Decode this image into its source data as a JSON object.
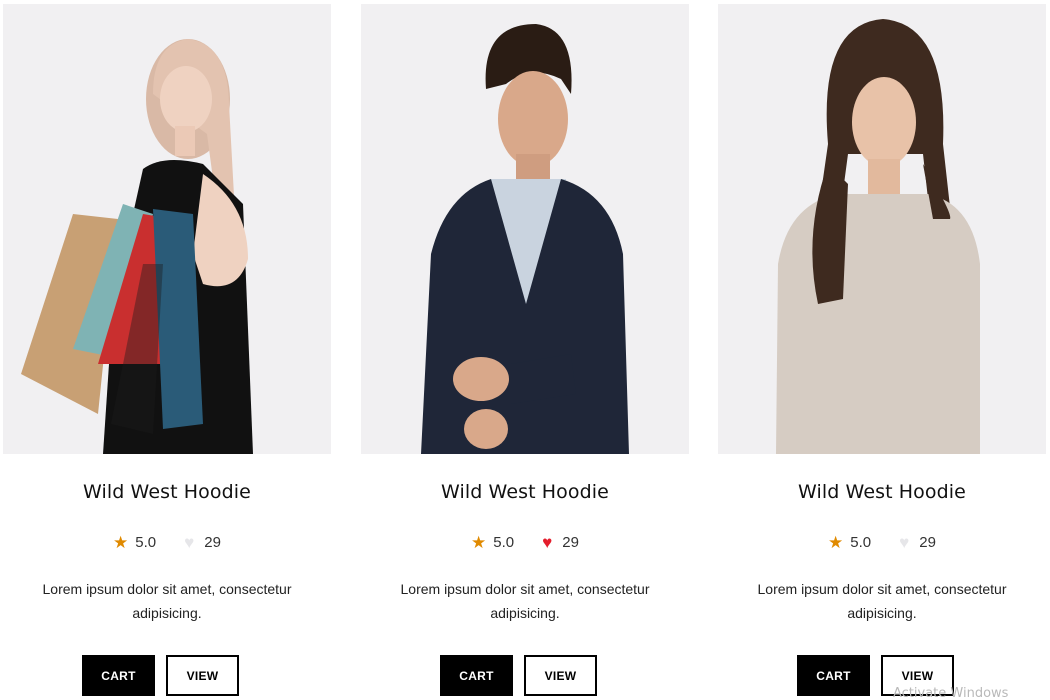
{
  "products": [
    {
      "name": "Wild West Hoodie",
      "rating": "5.0",
      "likes": "29",
      "liked": false,
      "description": "Lorem ipsum dolor sit amet, consectetur adipisicing.",
      "cart_label": "CART",
      "view_label": "VIEW",
      "image": "woman-with-shopping-bags"
    },
    {
      "name": "Wild West Hoodie",
      "rating": "5.0",
      "likes": "29",
      "liked": true,
      "description": "Lorem ipsum dolor sit amet, consectetur adipisicing.",
      "cart_label": "CART",
      "view_label": "VIEW",
      "image": "man-in-blazer"
    },
    {
      "name": "Wild West Hoodie",
      "rating": "5.0",
      "likes": "29",
      "liked": false,
      "description": "Lorem ipsum dolor sit amet, consectetur adipisicing.",
      "cart_label": "CART",
      "view_label": "VIEW",
      "image": "woman-in-beige-sweater"
    }
  ],
  "watermark": "Activate Windows",
  "colors": {
    "star": "#e08a00",
    "heart_on": "#e41d2c",
    "heart_off": "#e6e6e9",
    "button_dark": "#000000",
    "photo_bg": "#f1f0f2"
  }
}
